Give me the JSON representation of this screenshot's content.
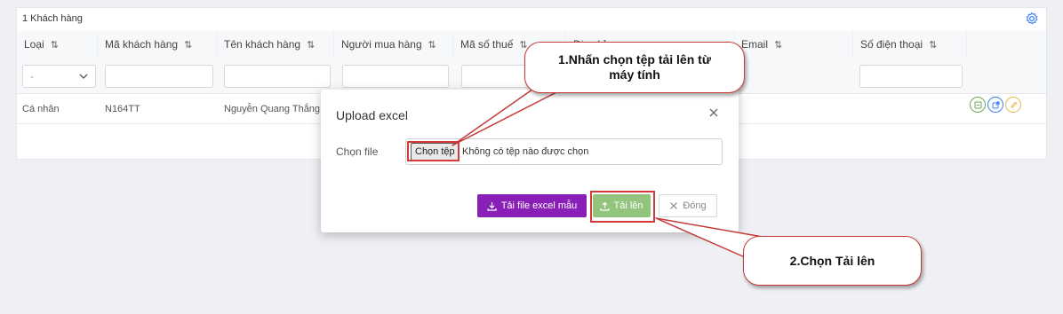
{
  "header": {
    "count_label": "1 Khách hàng"
  },
  "table": {
    "columns": [
      "Loại",
      "Mã khách hàng",
      "Tên khách hàng",
      "Người mua hàng",
      "Mã số thuế",
      "Địa chỉ",
      "Email",
      "Số điện thoại"
    ],
    "sort_icon": "⇅",
    "filter_select_value": "-",
    "row": {
      "type": "Cá nhân",
      "code": "N164TT",
      "name": "Nguyễn Quang Thắng"
    }
  },
  "modal": {
    "title": "Upload excel",
    "file_label": "Chọn file",
    "choose_button": "Chọn tệp",
    "no_file_text": "Không có tệp nào được chọn",
    "template_button": "Tải file excel mẫu",
    "upload_button": "Tải lên",
    "close_button": "Đóng"
  },
  "callouts": {
    "step1": "1.Nhấn chọn tệp tải lên từ máy tính",
    "step2": "2.Chọn Tải lên"
  },
  "colors": {
    "accent": "#3b82f6",
    "template_btn": "#8a1fb8",
    "upload_btn": "#93c47d",
    "annotation": "#d43a3a"
  }
}
